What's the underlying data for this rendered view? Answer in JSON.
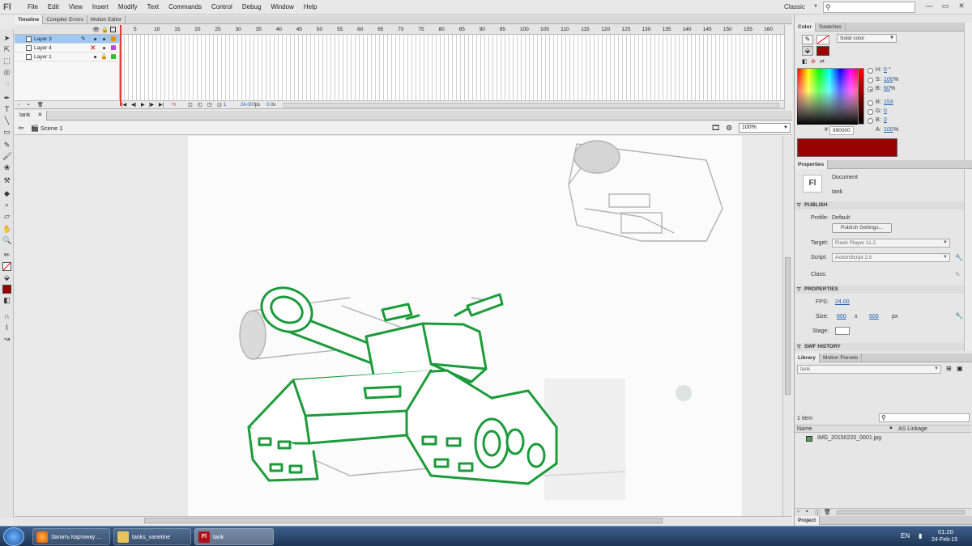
{
  "menubar": {
    "logo": "Fl",
    "items": [
      "File",
      "Edit",
      "View",
      "Insert",
      "Modify",
      "Text",
      "Commands",
      "Control",
      "Debug",
      "Window",
      "Help"
    ],
    "workspace": "Classic",
    "search_placeholder": ""
  },
  "timeline": {
    "tabs": [
      "Timeline",
      "Compiler Errors",
      "Motion Editor"
    ],
    "ruler": [
      "5",
      "10",
      "15",
      "20",
      "25",
      "30",
      "35",
      "40",
      "45",
      "50",
      "55",
      "60",
      "65",
      "70",
      "75",
      "80",
      "85",
      "90",
      "95",
      "100",
      "105",
      "110",
      "115",
      "120",
      "125",
      "130",
      "135",
      "140",
      "145",
      "150",
      "155",
      "160"
    ],
    "layers": [
      {
        "name": "Layer 3",
        "color": "#ff8a00",
        "selected": true
      },
      {
        "name": "Layer 4",
        "color": "#b44ad8",
        "selected": false
      },
      {
        "name": "Layer 1",
        "color": "#2fbf2f",
        "selected": false
      }
    ],
    "footer": {
      "frame": "1",
      "fps": "24.00",
      "fps_unit": "fps",
      "time": "0.0",
      "time_unit": "s"
    }
  },
  "document": {
    "tab": "tank",
    "scene": "Scene 1",
    "zoom": "100%"
  },
  "color_panel": {
    "tabs": [
      "Color",
      "Swatches"
    ],
    "fill_type": "Solid color",
    "hue_label": "H:",
    "hue": "0",
    "hue_unit": "°",
    "sat_label": "S:",
    "sat": "100",
    "sat_unit": "%",
    "bri_label": "B:",
    "bri": "60",
    "bri_unit": "%",
    "r_label": "R:",
    "r": "153",
    "g_label": "G:",
    "g": "0",
    "b_label": "B:",
    "b": "0",
    "a_label": "A:",
    "alpha": "100",
    "alpha_unit": "%",
    "hex_label": "#",
    "hex": "990000",
    "swatch_color": "#990000"
  },
  "properties": {
    "tab": "Properties",
    "doc_type": "Document",
    "doc_name": "tank",
    "doc_icon": "Fl",
    "publish": {
      "section": "PUBLISH",
      "profile_label": "Profile:",
      "profile": "Default",
      "settings_btn": "Publish Settings...",
      "target_label": "Target:",
      "target": "Flash Player 11.2",
      "script_label": "Script:",
      "script": "ActionScript 2.0",
      "class_label": "Class:"
    },
    "props": {
      "section": "PROPERTIES",
      "fps_label": "FPS:",
      "fps": "24.00",
      "size_label": "Size:",
      "width": "800",
      "x": "x",
      "height": "600",
      "unit": "px",
      "stage_label": "Stage:"
    },
    "swf_history": "SWF HISTORY"
  },
  "library": {
    "tabs": [
      "Library",
      "Motion Presets"
    ],
    "doc": "tank",
    "count": "1 item",
    "col_name": "Name",
    "col_linkage": "AS Linkage",
    "items": [
      "IMG_20150220_0001.jpg"
    ]
  },
  "project_tab": "Project",
  "taskbar": {
    "tasks": [
      "Залить Картинку ...",
      "tanks_vanetine",
      "tank"
    ],
    "lang": "EN",
    "time": "01:20",
    "date": "24-Feb-15"
  }
}
